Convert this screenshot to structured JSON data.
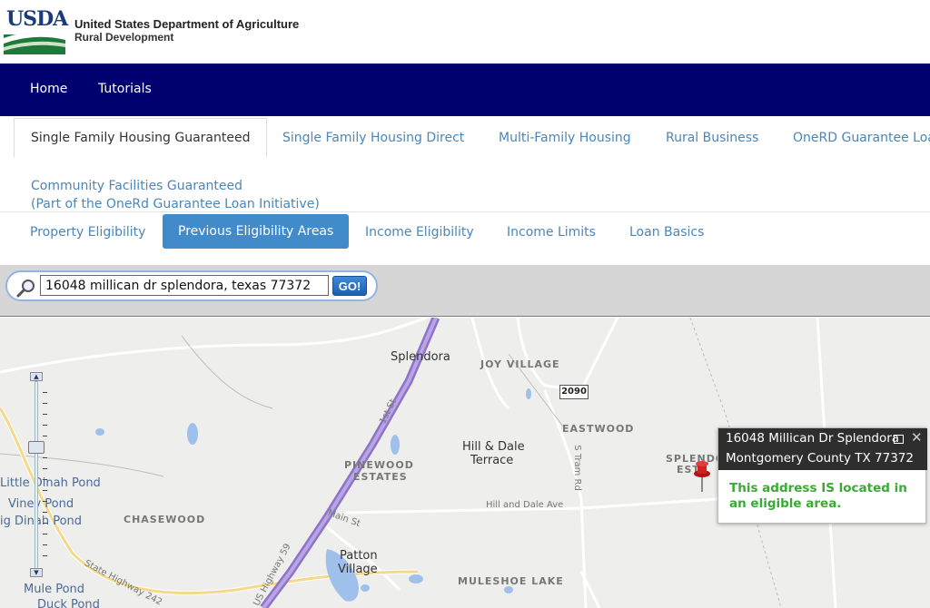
{
  "header": {
    "logo_text": "USDA",
    "agency_name": "United States Department of Agriculture",
    "agency_sub": "Rural Development"
  },
  "nav": {
    "home": "Home",
    "tutorials": "Tutorials"
  },
  "program_tabs": {
    "sfh_guaranteed": "Single Family Housing Guaranteed",
    "sfh_direct": "Single Family Housing Direct",
    "multi_family": "Multi-Family Housing",
    "rural_business": "Rural Business",
    "onerd": "OneRD Guarantee Loa",
    "cf_line1": "Community Facilities Guaranteed",
    "cf_line2": "(Part of the OneRd Guarantee Loan Initiative)"
  },
  "sub_tabs": {
    "property": "Property Eligibility",
    "previous": "Previous Eligibility Areas",
    "income": "Income Eligibility",
    "limits": "Income Limits",
    "basics": "Loan Basics"
  },
  "search": {
    "value": "16048 millican dr splendora, texas 77372",
    "go_label": "GO!"
  },
  "map": {
    "labels": {
      "splendora": "Splendora",
      "joy_village": "JOY VILLAGE",
      "eastwood": "EASTWOOD",
      "hill_dale_1": "Hill & Dale",
      "hill_dale_2": "Terrace",
      "pinewood_1": "PINEWOOD",
      "pinewood_2": "ESTATES",
      "chasewood": "CHASEWOOD",
      "little_dinah": "Little Dinah Pond",
      "viney": "Viney Pond",
      "big_dinah": "ig Dinah Pond",
      "patton_1": "Patton",
      "patton_2": "Village",
      "muleshoe": "MULESHOE LAKE",
      "mule_pond": "Mule Pond",
      "duck_pond": "Duck Pond",
      "splendora_est_1": "SPLENDO",
      "splendora_est_2": "ESTA",
      "hill_dale_ave": "Hill and Dale Ave",
      "main_st": "Main St",
      "s_tram_rd": "S Tram Rd",
      "state_hwy_242": "State Highway 242",
      "us_hwy_59": "US Highway 59",
      "first_st": "1st St",
      "shield_2090": "2090"
    },
    "popup": {
      "line1": "16048 Millican Dr Splendora",
      "line2": "Montgomery County TX 77372",
      "message": "This address IS located in an eligible area."
    }
  },
  "colors": {
    "navbar": "#00006e",
    "link": "#4a86b8",
    "active_tab": "#428bca",
    "eligible": "#3aa935",
    "pin": "#d32020",
    "highway": "#a98fd4"
  }
}
